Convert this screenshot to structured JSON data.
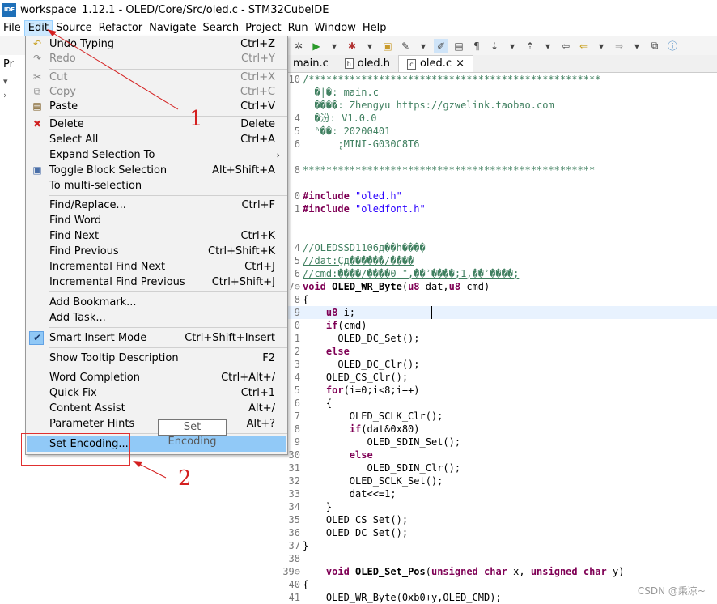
{
  "window": {
    "title": "workspace_1.12.1 - OLED/Core/Src/oled.c - STM32CubeIDE",
    "logo": "IDE"
  },
  "menubar": [
    "File",
    "Edit",
    "Source",
    "Refactor",
    "Navigate",
    "Search",
    "Project",
    "Run",
    "Window",
    "Help"
  ],
  "left_panel": {
    "tab_label": "Pr"
  },
  "editor_tabs": [
    {
      "label": "main.c",
      "active": false
    },
    {
      "label": "oled.h",
      "active": false
    },
    {
      "label": "oled.c",
      "active": true,
      "close": "×"
    }
  ],
  "edit_menu": {
    "items": [
      {
        "label": "Undo Typing",
        "shortcut": "Ctrl+Z",
        "icon": "undo-icon"
      },
      {
        "label": "Redo",
        "shortcut": "Ctrl+Y",
        "icon": "redo-icon",
        "disabled": true
      },
      {
        "label": "Cut",
        "shortcut": "Ctrl+X",
        "icon": "cut-icon",
        "disabled": true
      },
      {
        "label": "Copy",
        "shortcut": "Ctrl+C",
        "icon": "copy-icon",
        "disabled": true
      },
      {
        "label": "Paste",
        "shortcut": "Ctrl+V",
        "icon": "paste-icon"
      },
      {
        "label": "Delete",
        "shortcut": "Delete",
        "icon": "delete-icon"
      },
      {
        "label": "Select All",
        "shortcut": "Ctrl+A"
      },
      {
        "label": "Expand Selection To",
        "shortcut": "",
        "submenu": true
      },
      {
        "label": "Toggle Block Selection",
        "shortcut": "Alt+Shift+A",
        "icon": "block-selection-icon"
      },
      {
        "label": "To multi-selection",
        "shortcut": ""
      },
      {
        "label": "Find/Replace...",
        "shortcut": "Ctrl+F"
      },
      {
        "label": "Find Word",
        "shortcut": ""
      },
      {
        "label": "Find Next",
        "shortcut": "Ctrl+K"
      },
      {
        "label": "Find Previous",
        "shortcut": "Ctrl+Shift+K"
      },
      {
        "label": "Incremental Find Next",
        "shortcut": "Ctrl+J"
      },
      {
        "label": "Incremental Find Previous",
        "shortcut": "Ctrl+Shift+J"
      },
      {
        "label": "Add Bookmark...",
        "shortcut": ""
      },
      {
        "label": "Add Task...",
        "shortcut": ""
      },
      {
        "label": "Smart Insert Mode",
        "shortcut": "Ctrl+Shift+Insert",
        "checked": true
      },
      {
        "label": "Show Tooltip Description",
        "shortcut": "F2"
      },
      {
        "label": "Word Completion",
        "shortcut": "Ctrl+Alt+/"
      },
      {
        "label": "Quick Fix",
        "shortcut": "Ctrl+1"
      },
      {
        "label": "Content Assist",
        "shortcut": "Alt+/"
      },
      {
        "label": "Parameter Hints",
        "shortcut": "Alt+?"
      },
      {
        "label": "Set Encoding...",
        "shortcut": "",
        "highlighted": true
      }
    ],
    "tooltip": "Set Encoding"
  },
  "code": {
    "header_comment": [
      "/**************************************************",
      "  �|�: main.c",
      "  ����: Zhengyu https://gzwelink.taobao.com",
      "  �汾: V1.0.0",
      "  ʱ��: 20200401",
      "      ̨:MINI-G030C8T6",
      "",
      "**************************************************"
    ],
    "include1": "\"oled.h\"",
    "include2": "\"oledfont.h\"",
    "comment1": "//OLEDSSD1106д��һ���ֽ�",
    "comment2": "//dat:Ҫд������/����",
    "comment3": "//cmd:����/����־ 0,��ʾ����;1,��ʾ����;"
  },
  "annotations": {
    "n1": "1",
    "n2": "2"
  },
  "watermark": "CSDN @乘凉~",
  "colors": {
    "menu_highlight": "#91c9f7",
    "annotation_red": "#d42020",
    "keyword": "#7f0055",
    "string": "#2a00ff",
    "comment": "#3f7f5f"
  }
}
